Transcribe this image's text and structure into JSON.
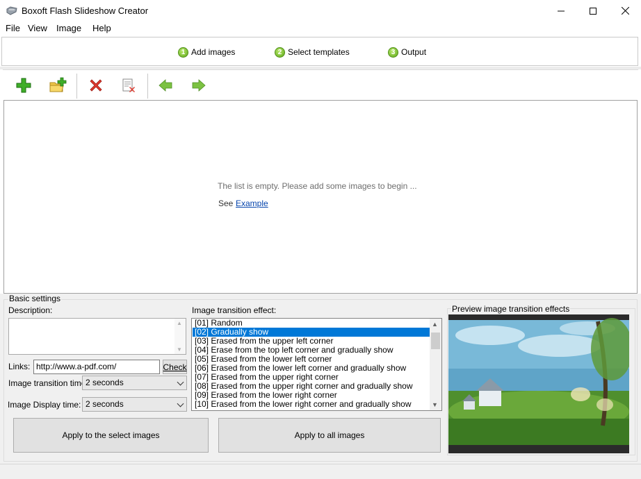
{
  "window": {
    "title": "Boxoft Flash Slideshow Creator"
  },
  "menu": {
    "items": [
      "File",
      "View",
      "Image",
      "Help"
    ]
  },
  "steps": [
    {
      "num": "1",
      "label": "Add images"
    },
    {
      "num": "2",
      "label": "Select templates"
    },
    {
      "num": "3",
      "label": "Output"
    }
  ],
  "toolbar": {
    "buttons": [
      "add-image-icon",
      "add-folder-icon",
      "delete-icon",
      "clear-list-icon",
      "move-left-icon",
      "move-right-icon"
    ]
  },
  "list": {
    "empty_message": "The list is empty. Please add some images to begin ...",
    "see_label": "See",
    "example_link": "Example"
  },
  "basic": {
    "group_label": "Basic settings",
    "description_label": "Description:",
    "links_label": "Links:",
    "links_value": "http://www.a-pdf.com/",
    "check_label": "Check",
    "transition_time_label": "Image transition time:",
    "transition_time_value": "2 seconds",
    "display_time_label": "Image Display time:",
    "display_time_value": "2 seconds",
    "effect_label": "Image transition effect:",
    "effects": [
      "[01] Random",
      "[02] Gradually show",
      "[03] Erased from the upper left corner",
      "[04] Erase from the top left corner and gradually show",
      "[05] Erased from the lower left corner",
      "[06] Erased from the lower left corner and gradually show",
      "[07] Erased from the upper right corner",
      "[08] Erased from the upper right corner and gradually show",
      "[09] Erased from the lower right corner",
      "[10] Erased from the lower right corner and gradually show"
    ],
    "selected_effect": "[02] Gradually show",
    "apply_selected_label": "Apply to the select images",
    "apply_all_label": "Apply to all images",
    "preview_label": "Preview image transition effects"
  },
  "colors": {
    "selection": "#0078d7",
    "link": "#0645ad"
  }
}
